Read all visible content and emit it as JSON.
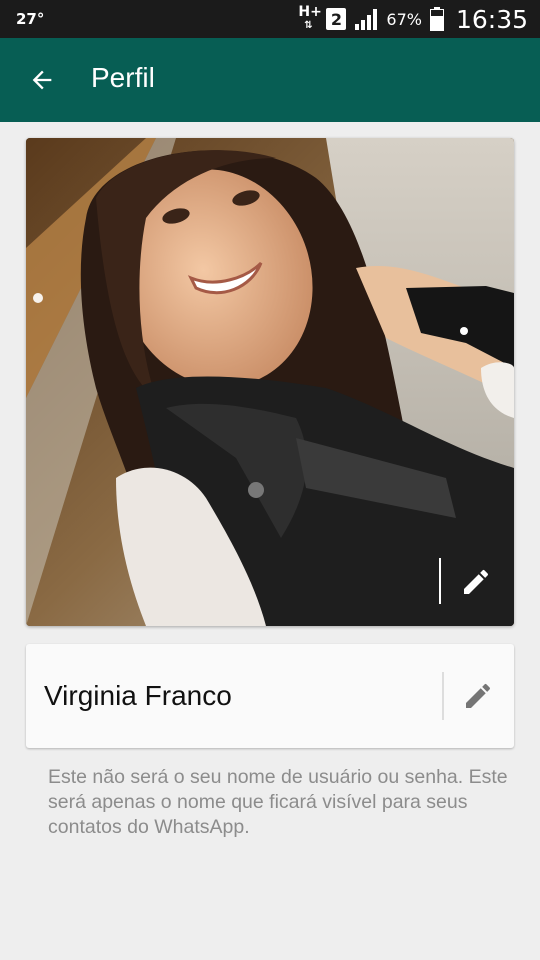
{
  "status_bar": {
    "temperature": "27°",
    "network_type": "H+",
    "sim_slot": "2",
    "battery_percent": "67%",
    "time": "16:35",
    "icons": [
      "hplus-icon",
      "sim-icon",
      "signal-icon",
      "battery-icon"
    ]
  },
  "app_bar": {
    "title": "Perfil",
    "background_color": "#075e54",
    "back_icon": "arrow-left-icon"
  },
  "profile_photo": {
    "description_icon": "photo",
    "edit_icon": "pencil-icon"
  },
  "name_field": {
    "value": "Virginia Franco",
    "edit_icon": "pencil-icon"
  },
  "hint": {
    "text": "Este não será o seu nome de usuário ou senha. Este será apenas o nome que ficará visível para seus contatos do WhatsApp."
  }
}
